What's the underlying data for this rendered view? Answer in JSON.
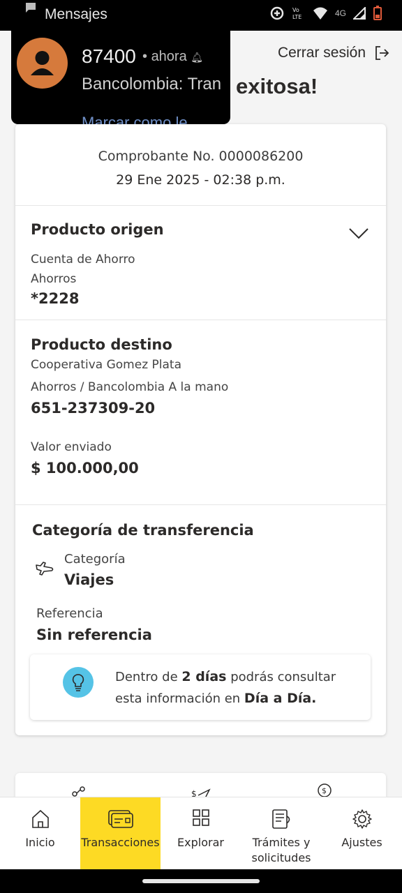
{
  "status_bar": {
    "app_name": "Mensajes",
    "network": "4G"
  },
  "notification": {
    "sender": "87400",
    "time": "ahora",
    "body": "Bancolombia: Tran",
    "action": "Marcar como le"
  },
  "header": {
    "logout_label": "Cerrar sesión",
    "title_partial": "exitosa!"
  },
  "receipt": {
    "number": "Comprobante No. 0000086200",
    "date": "29 Ene 2025 - 02:38 p.m."
  },
  "origin": {
    "title": "Producto origen",
    "account_type": "Cuenta de Ahorro",
    "subtype": "Ahorros",
    "number": "*2228"
  },
  "destination": {
    "title": "Producto destino",
    "name": "Cooperativa Gomez Plata",
    "detail": "Ahorros / Bancolombia A la mano",
    "number": "651-237309-20"
  },
  "amount": {
    "label": "Valor enviado",
    "value": "$ 100.000,00"
  },
  "category": {
    "title": "Categoría de transferencia",
    "label": "Categoría",
    "value": "Viajes",
    "ref_label": "Referencia",
    "ref_value": "Sin referencia"
  },
  "tip": {
    "part1": "Dentro de ",
    "bold1": "2 días",
    "part2": " podrás consultar esta información en ",
    "bold2": "Día a Día."
  },
  "nav": {
    "items": [
      {
        "label": "Inicio",
        "icon": "home-icon"
      },
      {
        "label": "Transacciones",
        "icon": "card-icon"
      },
      {
        "label": "Explorar",
        "icon": "grid-icon"
      },
      {
        "label": "Trámites y solicitudes",
        "icon": "document-icon"
      },
      {
        "label": "Ajustes",
        "icon": "gear-icon"
      }
    ],
    "active_index": 1
  },
  "colors": {
    "brand_yellow": "#fdda24",
    "notification_avatar": "#d67a3c",
    "tip_icon": "#55c3e6"
  }
}
